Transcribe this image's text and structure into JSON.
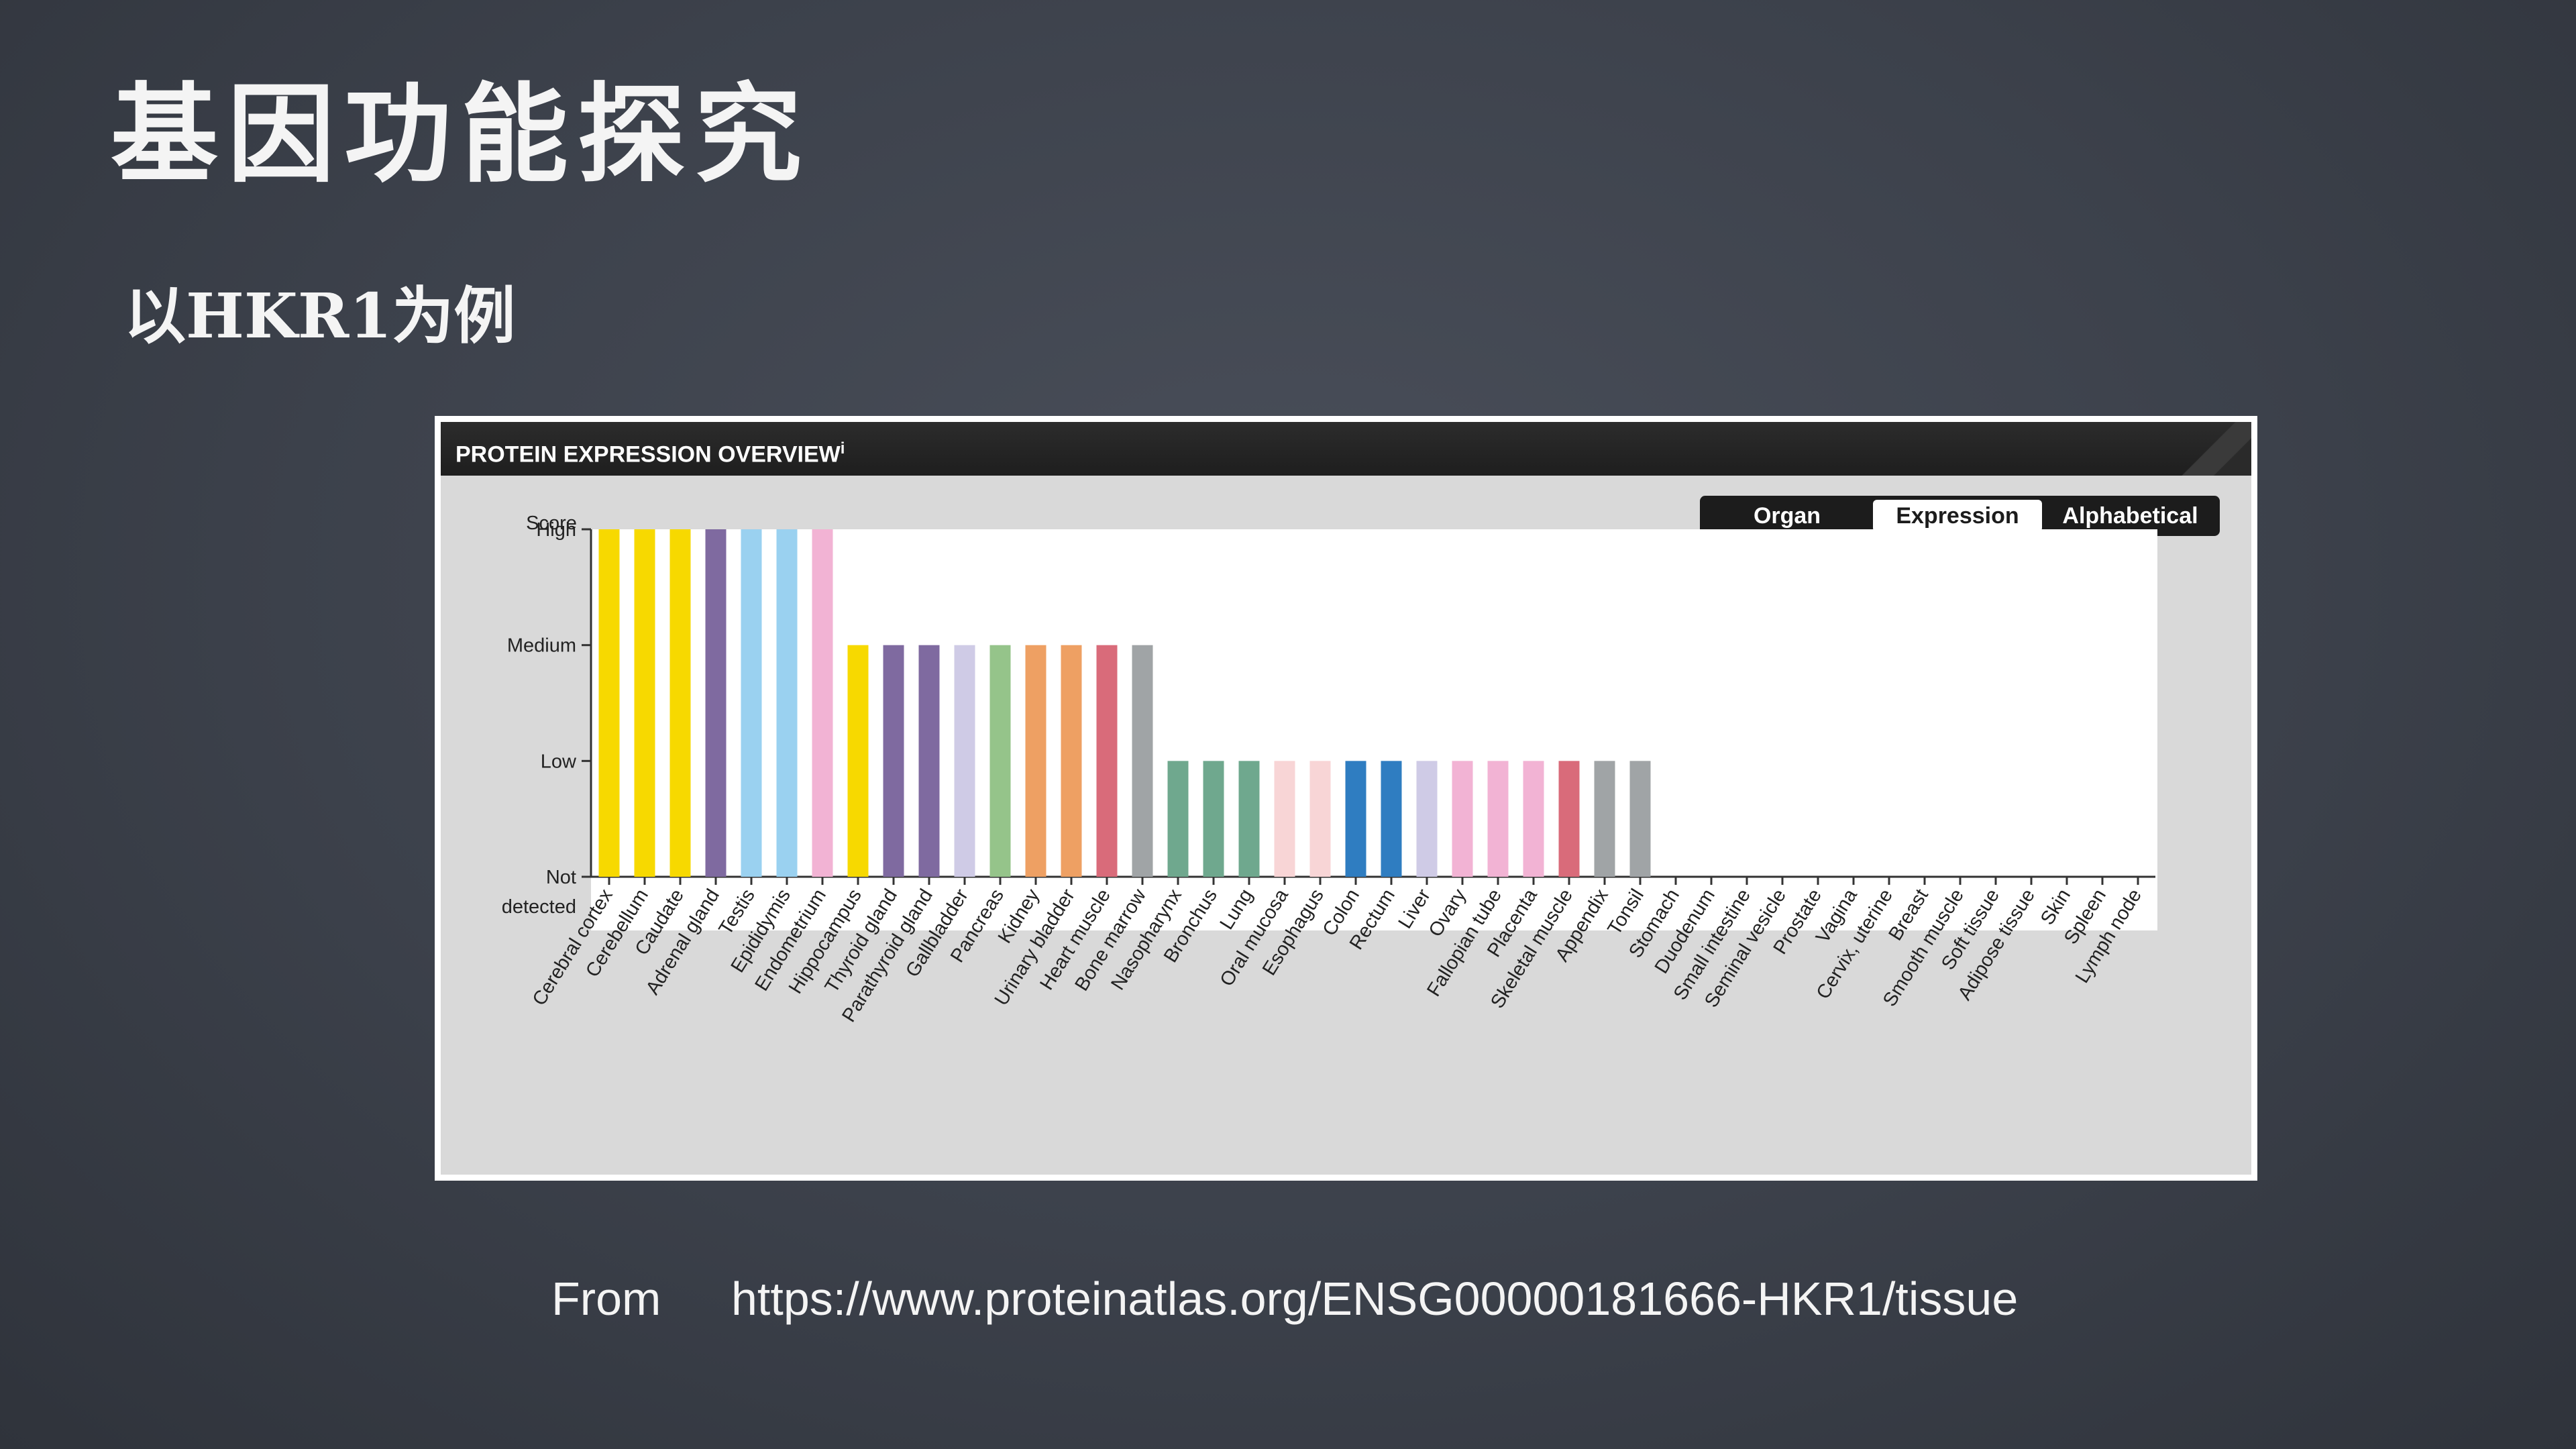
{
  "slide": {
    "title": "基因功能探究",
    "subtitle": "以HKR1为例",
    "footer_from": "From",
    "footer_url": "https://www.proteinatlas.org/ENSG00000181666-HKR1/tissue"
  },
  "panel": {
    "title": "PROTEIN EXPRESSION OVERVIEW",
    "info_mark": "i",
    "toggle": [
      {
        "label": "Organ",
        "active": false
      },
      {
        "label": "Expression",
        "active": true
      },
      {
        "label": "Alphabetical",
        "active": false
      }
    ]
  },
  "chart_data": {
    "type": "bar",
    "ylabel": "Score",
    "y_levels": [
      "Not detected",
      "Low",
      "Medium",
      "High"
    ],
    "ylim": [
      0,
      3
    ],
    "categories": [
      "Cerebral cortex",
      "Cerebellum",
      "Caudate",
      "Adrenal gland",
      "Testis",
      "Epididymis",
      "Endometrium",
      "Hippocampus",
      "Thyroid gland",
      "Parathyroid gland",
      "Gallbladder",
      "Pancreas",
      "Kidney",
      "Urinary bladder",
      "Heart muscle",
      "Bone marrow",
      "Nasopharynx",
      "Bronchus",
      "Lung",
      "Oral mucosa",
      "Esophagus",
      "Colon",
      "Rectum",
      "Liver",
      "Ovary",
      "Fallopian tube",
      "Placenta",
      "Skeletal muscle",
      "Appendix",
      "Tonsil",
      "Stomach",
      "Duodenum",
      "Small intestine",
      "Seminal vesicle",
      "Prostate",
      "Vagina",
      "Cervix, uterine",
      "Breast",
      "Smooth muscle",
      "Soft tissue",
      "Adipose tissue",
      "Skin",
      "Spleen",
      "Lymph node"
    ],
    "values": [
      3,
      3,
      3,
      3,
      3,
      3,
      3,
      2,
      2,
      2,
      2,
      2,
      2,
      2,
      2,
      2,
      1,
      1,
      1,
      1,
      1,
      1,
      1,
      1,
      1,
      1,
      1,
      1,
      1,
      1,
      0,
      0,
      0,
      0,
      0,
      0,
      0,
      0,
      0,
      0,
      0,
      0,
      0,
      0
    ],
    "colors": [
      "#f7d900",
      "#f7d900",
      "#f7d900",
      "#7f6aa0",
      "#9ad1f0",
      "#9ad1f0",
      "#f2b3d4",
      "#f7d900",
      "#7f6aa0",
      "#7f6aa0",
      "#cfcbe6",
      "#95c48a",
      "#eea063",
      "#eea063",
      "#d96b7a",
      "#a0a4a6",
      "#6fa88e",
      "#6fa88e",
      "#6fa88e",
      "#f8d5d6",
      "#f8d5d6",
      "#2f7dc1",
      "#2f7dc1",
      "#cfcbe6",
      "#f2b3d4",
      "#f2b3d4",
      "#f2b3d4",
      "#d96b7a",
      "#a0a4a6",
      "#a0a4a6",
      "#6fa88e",
      "#6fa88e",
      "#6fa88e",
      "#9ad1f0",
      "#9ad1f0",
      "#f2b3d4",
      "#f2b3d4",
      "#f2b3d4",
      "#d96b7a",
      "#d96b7a",
      "#d96b7a",
      "#a0a4a6",
      "#a0a4a6",
      "#a0a4a6"
    ],
    "grid": false
  }
}
